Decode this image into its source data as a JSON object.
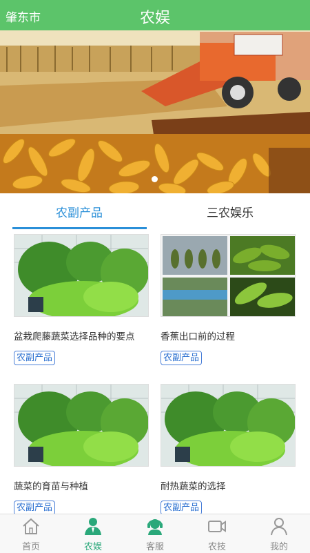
{
  "header": {
    "city": "肇东市",
    "title": "农娱"
  },
  "banner": {
    "image": "corn-harvest-photo",
    "page_indicator": {
      "current": 1,
      "total": 1
    }
  },
  "tabs": [
    {
      "label": "农副产品",
      "active": true
    },
    {
      "label": "三农娱乐",
      "active": false
    }
  ],
  "articles": [
    {
      "title": "盆栽爬藤蔬菜选择品种的要点",
      "tag": "农副产品",
      "image": "vegetable-greenhouse-photo"
    },
    {
      "title": "香蕉出口前的过程",
      "tag": "农副产品",
      "image": "banana-processing-photo"
    },
    {
      "title": "蔬菜的育苗与种植",
      "tag": "农副产品",
      "image": "vegetable-greenhouse-photo"
    },
    {
      "title": "耐热蔬菜的选择",
      "tag": "农副产品",
      "image": "vegetable-greenhouse-photo"
    }
  ],
  "bottom_nav": [
    {
      "label": "首页",
      "icon": "home-icon",
      "active": false
    },
    {
      "label": "农娱",
      "icon": "person-icon",
      "active": true
    },
    {
      "label": "客服",
      "icon": "headset-icon",
      "active": false
    },
    {
      "label": "农技",
      "icon": "video-icon",
      "active": false
    },
    {
      "label": "我的",
      "icon": "user-icon",
      "active": false
    }
  ],
  "colors": {
    "header": "#5cc46a",
    "tab_active": "#2a8fd8",
    "nav_active": "#2aa87a",
    "tag_border": "#4a7fd8"
  }
}
